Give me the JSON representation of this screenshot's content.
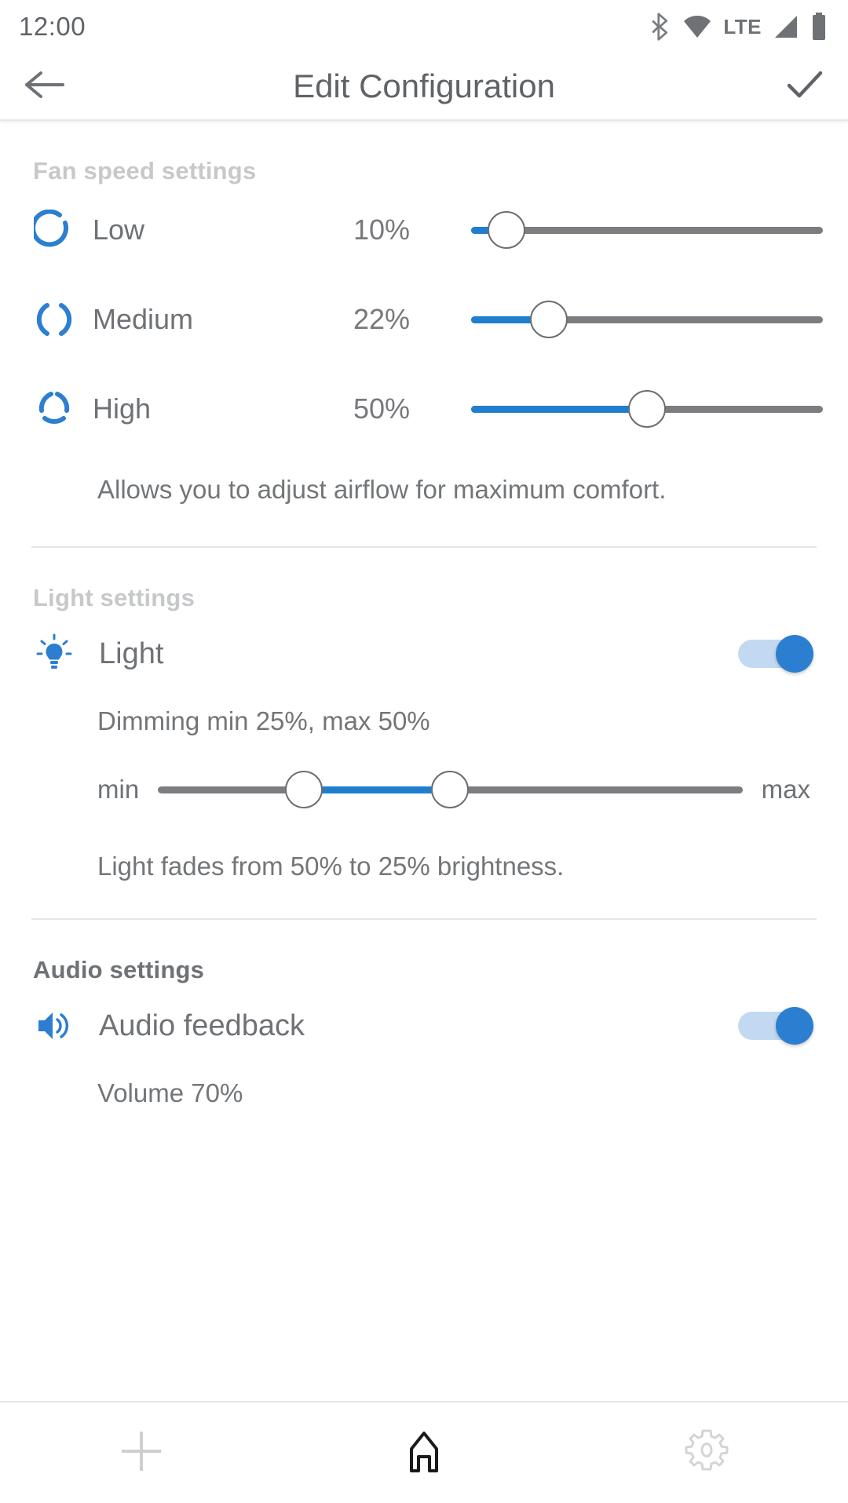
{
  "status_bar": {
    "time": "12:00",
    "icons": [
      "bluetooth-icon",
      "wifi-icon",
      "lte-label",
      "cellular-signal-icon",
      "battery-icon"
    ],
    "network_label": "LTE"
  },
  "app_bar": {
    "back_icon": "back-arrow-icon",
    "title": "Edit Configuration",
    "confirm_icon": "checkmark-icon"
  },
  "colors": {
    "accent_blue": "#2c7fd0",
    "slider_blue": "#1f7fce",
    "track_gray": "#7b7d80",
    "text_gray": "#6e7175",
    "header_gray": "#c6c8ca"
  },
  "sections": {
    "fan": {
      "header": "Fan speed settings",
      "rows": [
        {
          "icon": "fan-low-icon",
          "label": "Low",
          "value_text": "10%",
          "value": 10
        },
        {
          "icon": "fan-medium-icon",
          "label": "Medium",
          "value_text": "22%",
          "value": 22
        },
        {
          "icon": "fan-high-icon",
          "label": "High",
          "value_text": "50%",
          "value": 50
        }
      ],
      "hint": "Allows you to adjust airflow for maximum comfort."
    },
    "light": {
      "header": "Light settings",
      "row": {
        "icon": "lightbulb-icon",
        "label": "Light",
        "toggle_state": "on"
      },
      "dimming_text": "Dimming min 25%, max 50%",
      "range": {
        "min_label": "min",
        "max_label": "max",
        "min_value": 25,
        "max_value": 50
      },
      "hint": "Light fades from 50% to 25% brightness."
    },
    "audio": {
      "header": "Audio settings",
      "row": {
        "icon": "speaker-volume-icon",
        "label": "Audio feedback",
        "toggle_state": "on"
      },
      "volume_text": "Volume 70%"
    }
  },
  "bottom_nav": {
    "items": [
      {
        "icon": "plus-icon",
        "active": false
      },
      {
        "icon": "home-icon",
        "active": true
      },
      {
        "icon": "gear-icon",
        "active": false
      }
    ]
  }
}
